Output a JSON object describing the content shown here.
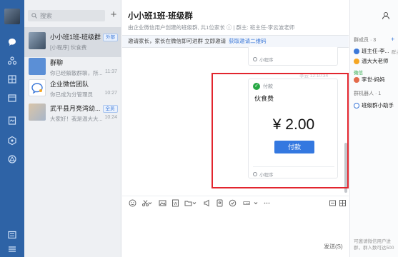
{
  "window": {
    "accent": "#2e63a6",
    "highlight": "#e2252e"
  },
  "nav_icons": [
    "message-icon",
    "contacts-icon",
    "workbench-icon",
    "calendar-icon",
    "doc-icon",
    "more-icon",
    "drive-icon",
    "menu-icon"
  ],
  "search": {
    "placeholder": "搜索"
  },
  "conversations": [
    {
      "name": "小小班1班-班级群",
      "badge": "外部",
      "message": "[小程序] 伙食费",
      "time": "",
      "selected": true
    },
    {
      "name": "群聊",
      "badge": "",
      "message": "你已经解散群聊，所...",
      "time": "11:37",
      "selected": false
    },
    {
      "name": "企业微信团队",
      "badge": "",
      "message": "你已成为分管理员",
      "time": "10:27",
      "selected": false
    },
    {
      "name": "武平县月亮湾幼...",
      "badge": "全员",
      "message": "大家好！我是温大大...",
      "time": "10:24",
      "selected": false
    }
  ],
  "chat": {
    "title": "小小班1班-班级群",
    "subtitle": "由企业微信用户创建的班级群, 共1位家长 ⓘ | 群主: 班主任-李云波老师",
    "notice_text": "邀请家长，家长在微信即可进群 立即邀请",
    "notice_link": "获取邀请二维码",
    "mini_program_label": "小程序",
    "time_label": "李云 12:10:34",
    "payment": {
      "header": "付款",
      "merchant": "伙食费",
      "amount": "¥ 2.00",
      "pay_button": "付款"
    },
    "send_label": "发送(S)"
  },
  "members_panel": {
    "members_title": "群成员 · 3",
    "members": [
      {
        "name": "班主任-李...",
        "tag": "群主"
      },
      {
        "name": "温大大老师",
        "tag": ""
      }
    ],
    "wechat_label": "微信",
    "wechat_members": [
      {
        "name": "李世-妈妈"
      }
    ],
    "bots_title": "群机器人 · 1",
    "bots": [
      {
        "name": "班级群小助手"
      }
    ],
    "footer": "可邀请微信用户进群，群人数可达500"
  }
}
